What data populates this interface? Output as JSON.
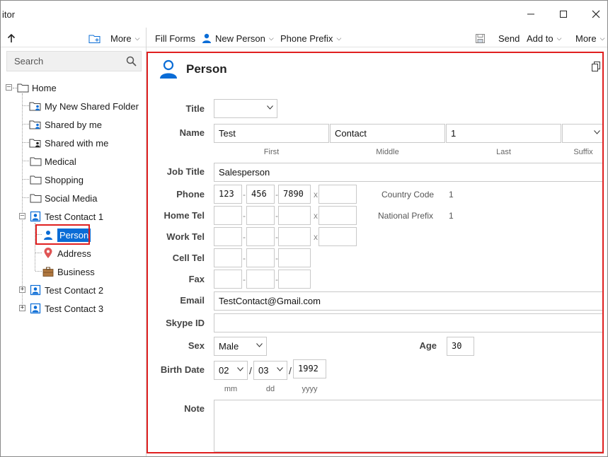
{
  "window": {
    "title": "itor"
  },
  "toolbar": {
    "more_left": "More",
    "fill_forms": "Fill Forms",
    "new_person": "New Person",
    "phone_prefix": "Phone Prefix",
    "send": "Send",
    "add_to": "Add to",
    "more_right": "More"
  },
  "sidebar": {
    "search_placeholder": "Search",
    "tree": {
      "home": "Home",
      "items": [
        "My New Shared Folder",
        "Shared by me",
        "Shared with me",
        "Medical",
        "Shopping",
        "Social Media"
      ],
      "contact1": "Test Contact 1",
      "person": "Person",
      "address": "Address",
      "business": "Business",
      "contact2": "Test Contact 2",
      "contact3": "Test Contact 3"
    }
  },
  "form": {
    "heading": "Person",
    "labels": {
      "title": "Title",
      "name": "Name",
      "job_title": "Job Title",
      "phone": "Phone",
      "home_tel": "Home Tel",
      "work_tel": "Work Tel",
      "cell_tel": "Cell Tel",
      "fax": "Fax",
      "email": "Email",
      "skype": "Skype ID",
      "sex": "Sex",
      "age": "Age",
      "birth_date": "Birth Date",
      "note": "Note"
    },
    "name": {
      "first": "Test",
      "middle": "Contact",
      "last": "1",
      "first_sub": "First",
      "middle_sub": "Middle",
      "last_sub": "Last",
      "suffix_sub": "Suffix"
    },
    "job_title": "Salesperson",
    "phone": {
      "p1": "123",
      "p2": "456",
      "p3": "7890",
      "ext_mark": "x"
    },
    "country_code": {
      "label": "Country Code",
      "value": "1"
    },
    "national_prefix": {
      "label": "National Prefix",
      "value": "1"
    },
    "email": "TestContact@Gmail.com",
    "sex": "Male",
    "age": "30",
    "birth": {
      "mm": "02",
      "dd": "03",
      "yyyy": "1992",
      "mm_sub": "mm",
      "dd_sub": "dd",
      "yyyy_sub": "yyyy",
      "sep": "/"
    },
    "dash": "-"
  },
  "colors": {
    "accent": "#0a6cd6",
    "highlight_border": "#e02020"
  }
}
